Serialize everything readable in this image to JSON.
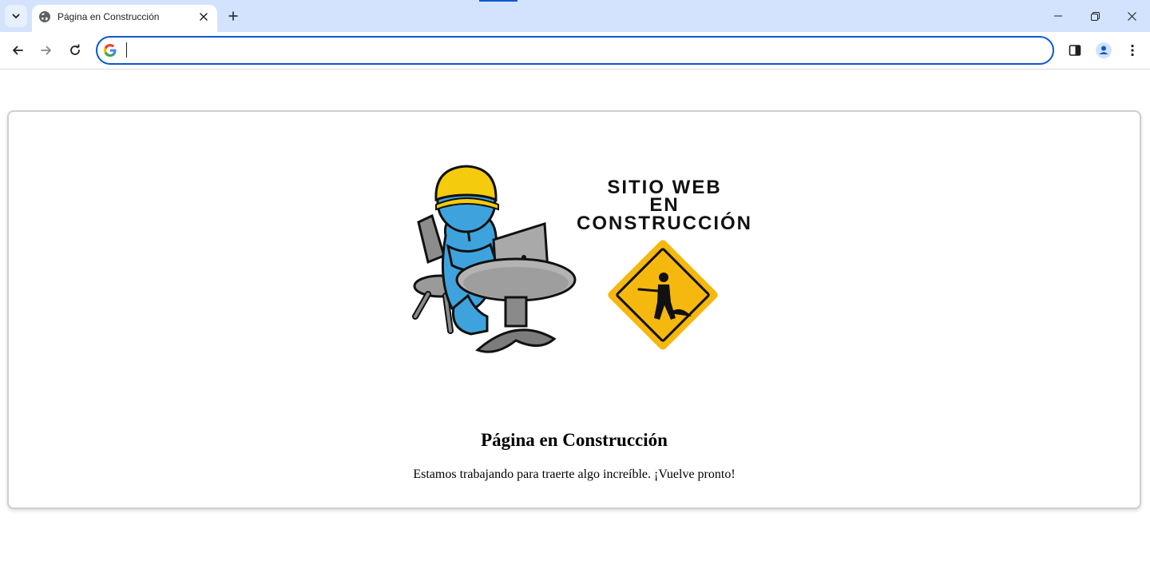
{
  "browser": {
    "tab": {
      "title": "Página en Construcción",
      "favicon": "globe-icon"
    },
    "omnibox": {
      "value": "",
      "icon": "google-icon"
    },
    "accent_color": "#0b57d0",
    "tabstrip_color": "#d3e3fd"
  },
  "page": {
    "image_text": [
      "SITIO WEB",
      "EN",
      "CONSTRUCCIÓN"
    ],
    "heading": "Página en Construcción",
    "message": "Estamos trabajando para traerte algo increíble. ¡Vuelve pronto!"
  }
}
